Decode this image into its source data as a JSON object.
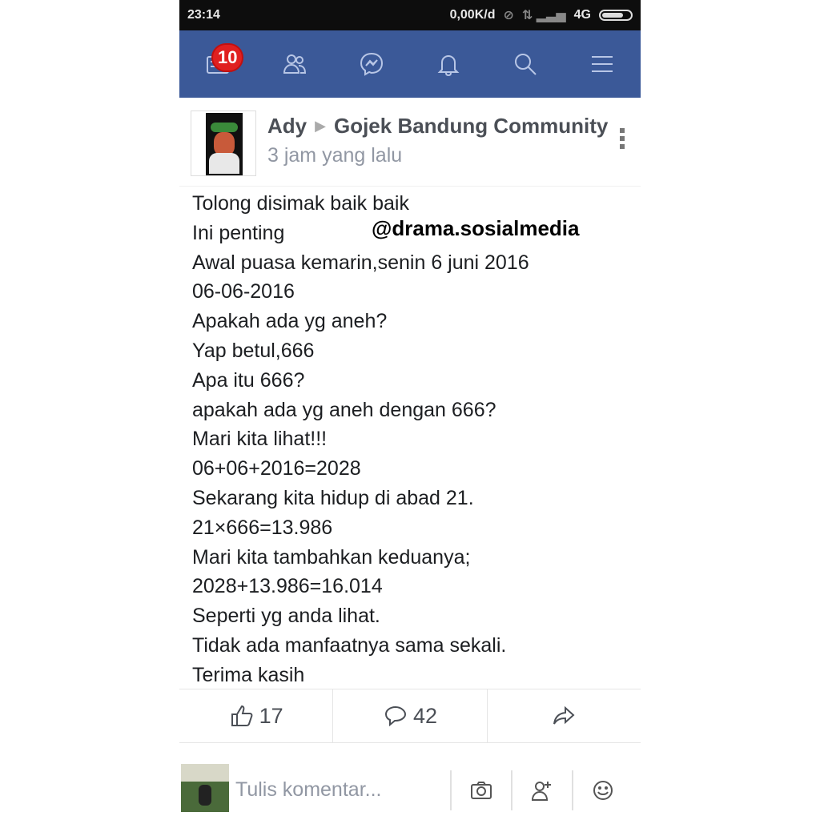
{
  "status_bar": {
    "time": "23:14",
    "net_speed": "0,00K/d",
    "network": "4G"
  },
  "navbar": {
    "notification_count": "10",
    "icons": [
      "news-feed-icon",
      "friends-icon",
      "messenger-icon",
      "notifications-icon",
      "search-icon",
      "menu-icon"
    ]
  },
  "post": {
    "author": "Ady",
    "group": "Gojek Bandung Community",
    "time_ago": "3 jam yang lalu",
    "lines": [
      "Tolong disimak baik baik",
      "Ini penting",
      "Awal puasa kemarin,senin 6 juni 2016",
      "06-06-2016",
      "Apakah ada yg aneh?",
      "Yap betul,666",
      "Apa itu 666?",
      "apakah ada yg aneh dengan 666?",
      "Mari kita lihat!!!",
      "06+06+2016=2028",
      "Sekarang kita hidup di abad 21.",
      "21×666=13.986",
      "Mari kita tambahkan keduanya;",
      "2028+13.986=16.014",
      "Seperti yg anda lihat.",
      "Tidak ada manfaatnya sama sekali.",
      "Terima kasih"
    ],
    "watermark": "@drama.sosialmedia",
    "likes": "17",
    "comments": "42"
  },
  "comment_bar": {
    "placeholder": "Tulis komentar..."
  },
  "colors": {
    "navbar": "#3b5998",
    "badge": "#e02020",
    "text": "#1c1e21"
  }
}
